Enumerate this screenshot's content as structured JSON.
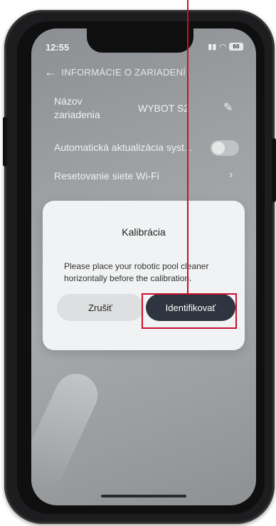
{
  "status_bar": {
    "time": "12:55",
    "signal_icon": "signal-bars-icon",
    "wifi_icon": "wifi-icon",
    "battery_level": "60"
  },
  "header": {
    "back_icon": "arrow-left-icon",
    "title": "INFORMÁCIE O ZARIADENÍ"
  },
  "settings": {
    "device_name_label": "Názov zariadenia",
    "device_name_value": "WYBOT S2",
    "edit_icon": "pencil-icon",
    "auto_update_label": "Automatická aktualizácia syst...",
    "auto_update_enabled": false,
    "wifi_reset_label": "Resetovanie siete Wi-Fi",
    "chevron_icon": "chevron-right-icon"
  },
  "dialog": {
    "title": "Kalibrácia",
    "message": "Please place your robotic pool cleaner horizontally before the calibration.",
    "cancel_label": "Zrušiť",
    "confirm_label": "Identifikovať"
  },
  "colors": {
    "annotation": "#c8102e",
    "confirm_button": "#2f3540",
    "dialog_bg": "#f1f2f3"
  }
}
